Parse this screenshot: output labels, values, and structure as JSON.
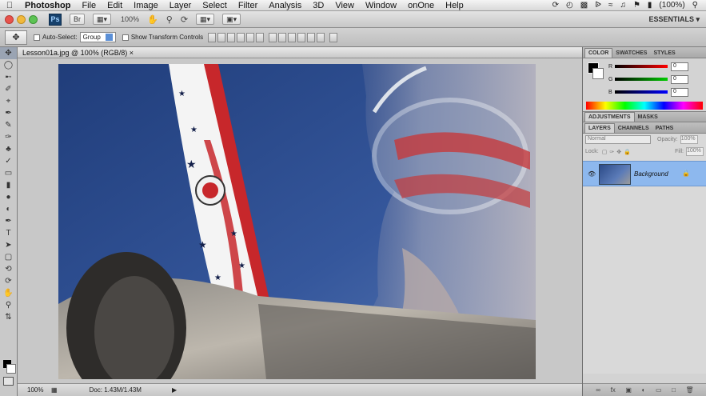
{
  "menubar": {
    "apple_icon": "apple-icon",
    "app_name": "Photoshop",
    "items": [
      "File",
      "Edit",
      "Image",
      "Layer",
      "Select",
      "Filter",
      "Analysis",
      "3D",
      "View",
      "Window",
      "onOne",
      "Help"
    ],
    "battery": "(100%)"
  },
  "appbar": {
    "ps_label": "Ps",
    "zoom_label": "100%",
    "workspace": "ESSENTIALS"
  },
  "options": {
    "auto_select_label": "Auto-Select:",
    "auto_select_value": "Group",
    "show_transform_label": "Show Transform Controls"
  },
  "document": {
    "tab_title": "Lesson01a.jpg @ 100% (RGB/8)",
    "zoom": "100%",
    "doc_size": "Doc: 1.43M/1.43M"
  },
  "panels": {
    "color_tabs": [
      "COLOR",
      "SWATCHES",
      "STYLES"
    ],
    "rgb": {
      "r": "0",
      "g": "0",
      "b": "0"
    },
    "adjust_tabs": [
      "ADJUSTMENTS",
      "MASKS"
    ],
    "layer_tabs": [
      "LAYERS",
      "CHANNELS",
      "PATHS"
    ],
    "blend_mode": "Normal",
    "opacity_label": "Opacity:",
    "opacity_value": "100%",
    "lock_label": "Lock:",
    "fill_label": "Fill:",
    "fill_value": "100%",
    "layer_name": "Background"
  },
  "colors": {
    "accent_layer": "#8db8ee",
    "sky": "#2f4c8f"
  }
}
